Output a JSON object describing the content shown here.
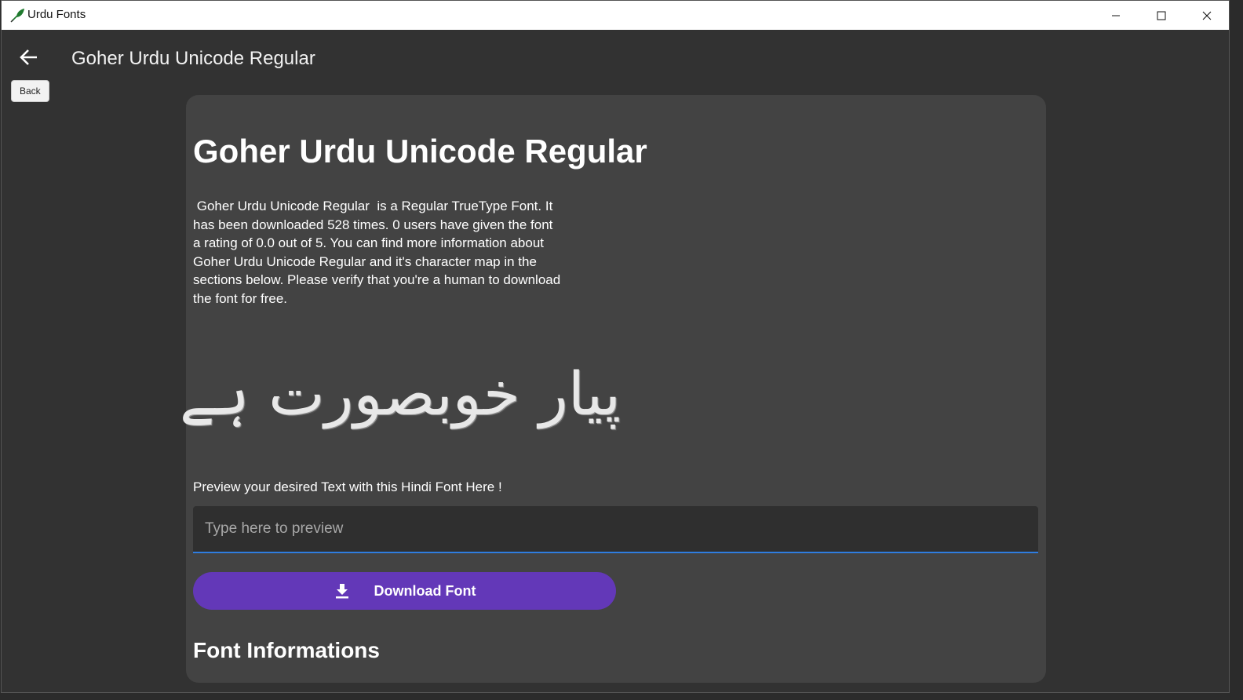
{
  "window": {
    "title": "Urdu Fonts"
  },
  "header": {
    "title": "Goher Urdu Unicode Regular",
    "back_tooltip": "Back"
  },
  "font_card": {
    "heading": "Goher Urdu Unicode Regular",
    "description": " Goher Urdu Unicode Regular  is a Regular TrueType Font. It has been downloaded 528 times. 0 users have given the font a rating of 0.0 out of 5. You can find more information about Goher Urdu Unicode Regular and it's character map in the sections below. Please verify that you're a human to download the font for free.",
    "sample_text": "پیار خوبصورت ہے",
    "preview_label": "Preview your desired Text with this Hindi Font Here !",
    "preview_placeholder": "Type here to preview",
    "download_label": "Download Font",
    "info_heading": "Font Informations"
  },
  "icons": {
    "app": "feather-icon",
    "back": "arrow-left-icon",
    "download": "download-icon",
    "minimize": "minimize-icon",
    "maximize": "maximize-icon",
    "close": "close-icon"
  },
  "colors": {
    "accent": "#6338b8",
    "input_underline": "#2f7de0",
    "card_bg": "#434343",
    "app_bg": "#323232"
  }
}
